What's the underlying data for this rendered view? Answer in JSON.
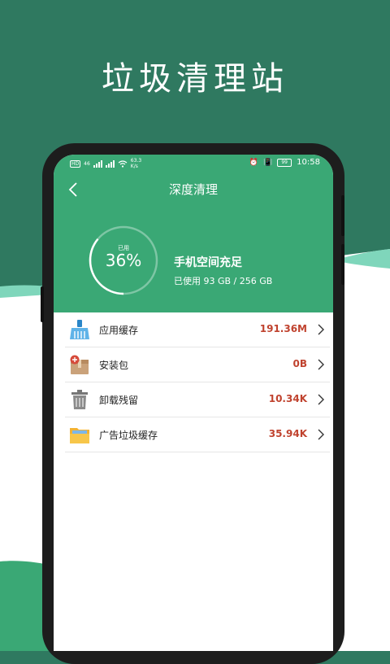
{
  "promo": {
    "title": "垃圾清理站"
  },
  "colors": {
    "header_green": "#3aa875",
    "bg_dark": "#2f7960",
    "accent_value": "#c0432f"
  },
  "status_bar": {
    "left_badges": [
      "HD",
      "HD"
    ],
    "signal_left": "46",
    "network_speed": "63.3",
    "network_unit": "K/s",
    "battery": "99",
    "time": "10:58"
  },
  "nav": {
    "title": "深度清理",
    "back_icon": "chevron-left-icon"
  },
  "storage": {
    "gauge_label": "已用",
    "used_percent_text": "36%",
    "used_fraction": 0.36,
    "status_title": "手机空间充足",
    "status_sub": "已使用 93 GB / 256 GB"
  },
  "items": [
    {
      "label": "应用缓存",
      "value": "191.36M",
      "icon": "broom-icon"
    },
    {
      "label": "安装包",
      "value": "0B",
      "icon": "package-icon"
    },
    {
      "label": "卸载残留",
      "value": "10.34K",
      "icon": "trash-icon"
    },
    {
      "label": "广告垃圾缓存",
      "value": "35.94K",
      "icon": "folder-icon"
    }
  ]
}
